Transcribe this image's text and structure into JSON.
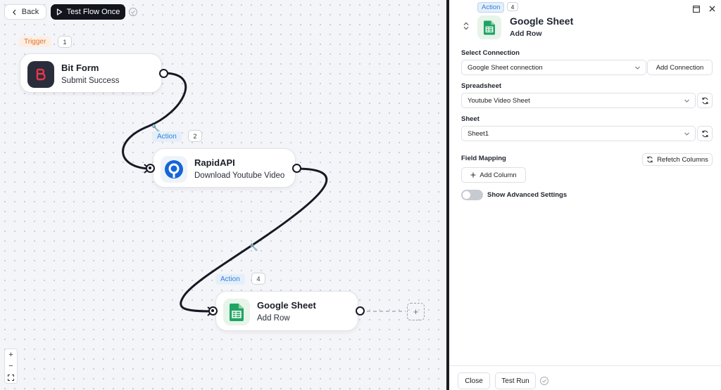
{
  "toolbar": {
    "back_label": "Back",
    "test_flow_label": "Test Flow Once"
  },
  "nodes": {
    "trigger": {
      "tag": "Trigger",
      "step": "1",
      "title": "Bit Form",
      "subtitle": "Submit Success",
      "icon": "bitform-logo-icon"
    },
    "action1": {
      "tag": "Action",
      "step": "2",
      "title": "RapidAPI",
      "subtitle": "Download Youtube Video",
      "icon": "rapidapi-logo-icon"
    },
    "action2": {
      "tag": "Action",
      "step": "4",
      "title": "Google Sheet",
      "subtitle": "Add Row",
      "icon": "google-sheet-icon"
    }
  },
  "zoom": {
    "in": "+",
    "out": "−"
  },
  "add_node_symbol": "+",
  "panel": {
    "tag": "Action",
    "step": "4",
    "title": "Google Sheet",
    "subtitle": "Add Row",
    "select_connection": {
      "label": "Select Connection",
      "value": "Google Sheet connection",
      "add_button": "Add Connection"
    },
    "spreadsheet": {
      "label": "Spreadsheet",
      "value": "Youtube Video Sheet"
    },
    "sheet": {
      "label": "Sheet",
      "value": "Sheet1"
    },
    "field_mapping": {
      "label": "Field Mapping",
      "refetch_button": "Refetch Columns",
      "add_column_button": "Add Column"
    },
    "advanced": {
      "label": "Show Advanced Settings",
      "enabled": false
    },
    "footer": {
      "close_label": "Close",
      "test_run_label": "Test Run"
    }
  },
  "colors": {
    "trigger_tag": "#e0732b",
    "action_tag": "#2f80d8",
    "wire": "#161924",
    "sheet_green": "#1fa463",
    "rapidapi_blue": "#1565d8",
    "bitform_red": "#e8364b"
  }
}
